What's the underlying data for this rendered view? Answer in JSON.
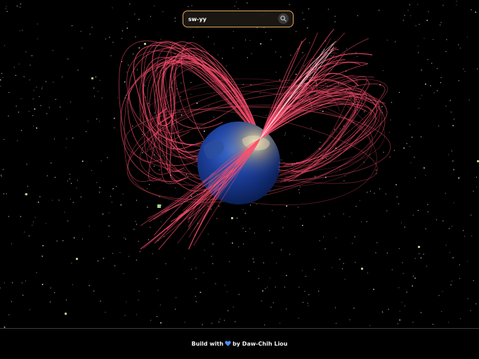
{
  "search": {
    "value": "sw-yy",
    "button_icon": "search-icon"
  },
  "footer": {
    "prefix": "Build with",
    "heart_icon": "heart-icon",
    "heart_color": "#4a8ff0",
    "suffix": "by Daw-Chih Liou"
  },
  "colors": {
    "arc": "#ff4f6e",
    "globe": "#1c3f9c",
    "search_border": "#e0a85a",
    "background": "#000000"
  }
}
